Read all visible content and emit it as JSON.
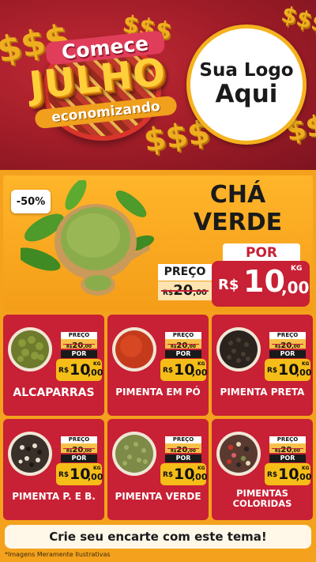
{
  "header": {
    "campaign": {
      "line1": "Comece",
      "line2": "JULHO",
      "line3": "economizando"
    },
    "logo": {
      "line1": "Sua Logo",
      "line2": "Aqui"
    },
    "money_symbol": "$$$"
  },
  "featured": {
    "discount": "-50%",
    "name_line1": "CHÁ",
    "name_line2": "VERDE",
    "price_label": "PREÇO",
    "old_price": {
      "currency": "R$",
      "integer": "20",
      "decimal": ",00"
    },
    "por_label": "POR",
    "new_price": {
      "currency": "R$",
      "integer": "10",
      "decimal": ",00",
      "unit": "KG"
    }
  },
  "products": [
    {
      "name": "ALCAPARRAS",
      "price_label": "PREÇO",
      "old": {
        "currency": "R$",
        "integer": "20",
        "decimal": ",00"
      },
      "por_label": "POR",
      "new": {
        "currency": "R$",
        "integer": "10",
        "decimal": ",00",
        "unit": "KG"
      }
    },
    {
      "name": "PIMENTA EM PÓ",
      "price_label": "PREÇO",
      "old": {
        "currency": "R$",
        "integer": "20",
        "decimal": ",00"
      },
      "por_label": "POR",
      "new": {
        "currency": "R$",
        "integer": "10",
        "decimal": ",00",
        "unit": "KG"
      }
    },
    {
      "name": "PIMENTA PRETA",
      "price_label": "PREÇO",
      "old": {
        "currency": "R$",
        "integer": "20",
        "decimal": ",00"
      },
      "por_label": "POR",
      "new": {
        "currency": "R$",
        "integer": "10",
        "decimal": ",00",
        "unit": "KG"
      }
    },
    {
      "name": "PIMENTA P. E B.",
      "price_label": "PREÇO",
      "old": {
        "currency": "R$",
        "integer": "20",
        "decimal": ",00"
      },
      "por_label": "POR",
      "new": {
        "currency": "R$",
        "integer": "10",
        "decimal": ",00",
        "unit": "KG"
      }
    },
    {
      "name": "PIMENTA VERDE",
      "price_label": "PREÇO",
      "old": {
        "currency": "R$",
        "integer": "20",
        "decimal": ",00"
      },
      "por_label": "POR",
      "new": {
        "currency": "R$",
        "integer": "10",
        "decimal": ",00",
        "unit": "KG"
      }
    },
    {
      "name_line1": "PIMENTAS",
      "name_line2": "COLORIDAS",
      "price_label": "PREÇO",
      "old": {
        "currency": "R$",
        "integer": "20",
        "decimal": ",00"
      },
      "por_label": "POR",
      "new": {
        "currency": "R$",
        "integer": "10",
        "decimal": ",00",
        "unit": "KG"
      }
    }
  ],
  "footer": {
    "cta": "Crie seu encarte com este tema!",
    "disclaimer": "*Imagens Meramente Ilustrativas"
  },
  "colors": {
    "header_red": "#9e1c27",
    "orange_bg": "#f4a21d",
    "card_red": "#c82034",
    "price_yellow": "#f5bd17",
    "logo_ring": "#f5b21f"
  }
}
